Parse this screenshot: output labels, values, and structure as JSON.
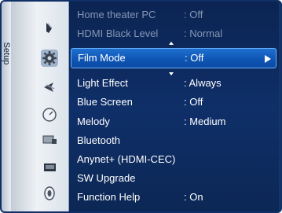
{
  "sidebar": {
    "tab_label": "Setup",
    "icons": [
      "picture-icon",
      "setup-gear-icon",
      "sound-icon",
      "channel-dial-icon",
      "input-icon",
      "application-icon",
      "support-icon"
    ]
  },
  "menu": {
    "items": [
      {
        "label": "Home theater PC",
        "value": ": Off",
        "state": "dim"
      },
      {
        "label": "HDMI Black Level",
        "value": ": Normal",
        "state": "dim"
      },
      {
        "label": "Film Mode",
        "value": ": Off",
        "state": "selected"
      },
      {
        "label": "Light Effect",
        "value": ": Always",
        "state": "normal"
      },
      {
        "label": "Blue Screen",
        "value": ": Off",
        "state": "normal"
      },
      {
        "label": "Melody",
        "value": ": Medium",
        "state": "normal"
      },
      {
        "label": "Bluetooth",
        "value": "",
        "state": "normal"
      },
      {
        "label": "Anynet+ (HDMI-CEC)",
        "value": "",
        "state": "normal"
      },
      {
        "label": "SW Upgrade",
        "value": "",
        "state": "normal"
      },
      {
        "label": "Function Help",
        "value": ": On",
        "state": "normal"
      }
    ]
  },
  "colors": {
    "background": "#0c2a5c",
    "highlight": "#1e70d0",
    "dim_text": "#8697b6"
  }
}
